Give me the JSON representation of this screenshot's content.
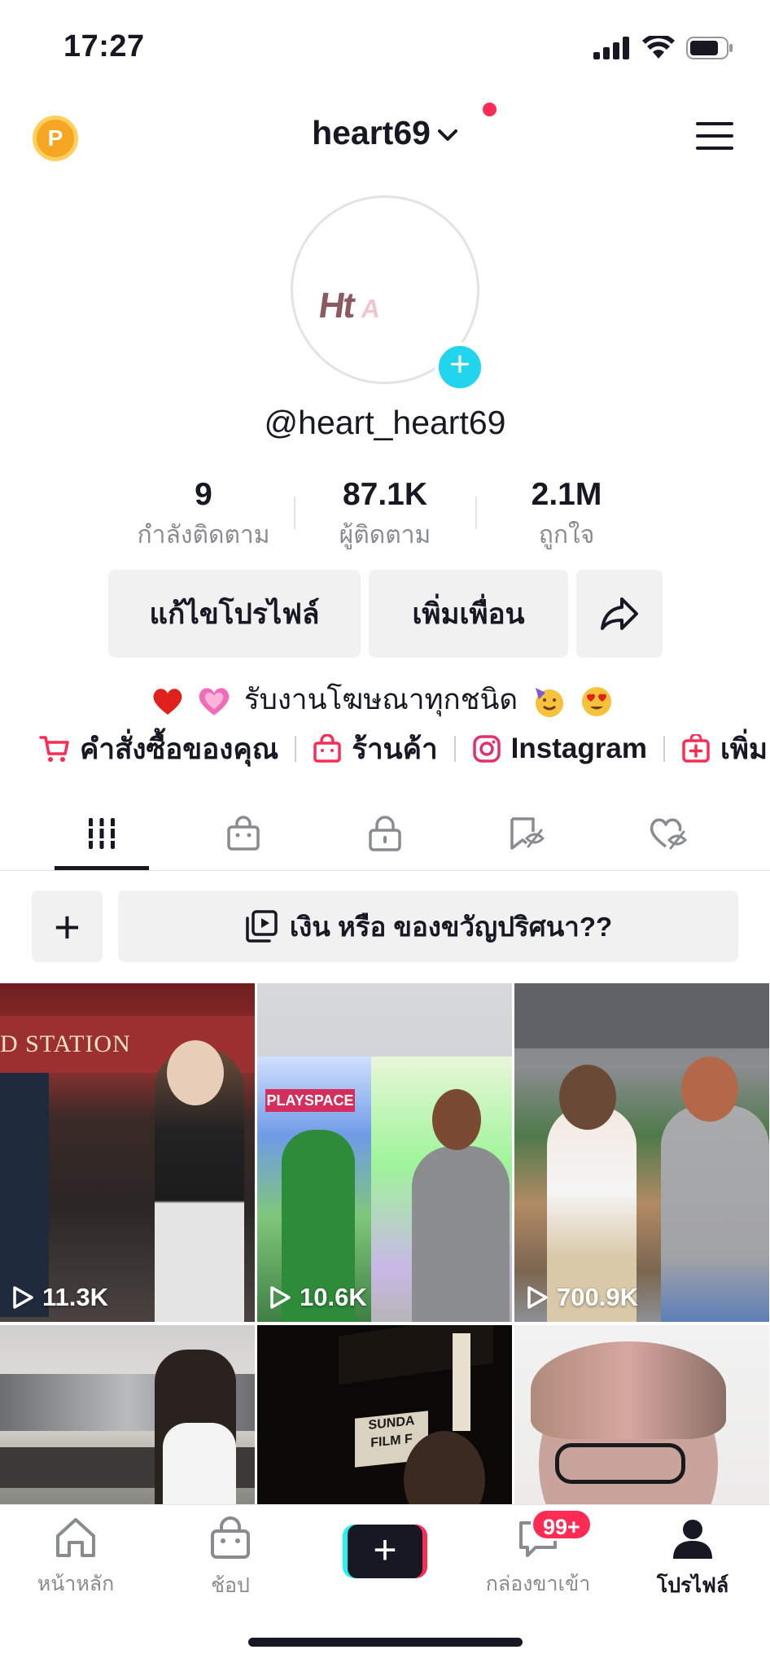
{
  "status_bar": {
    "time": "17:27"
  },
  "header": {
    "username": "heart69",
    "coin_label": "P"
  },
  "profile": {
    "avatar_text": "Ht",
    "avatar_text_2": "A",
    "handle": "@heart_heart69",
    "stats": [
      {
        "value": "9",
        "label": "กำลังติดตาม"
      },
      {
        "value": "87.1K",
        "label": "ผู้ติดตาม"
      },
      {
        "value": "2.1M",
        "label": "ถูกใจ"
      }
    ],
    "edit_profile_label": "แก้ไขโปรไฟล์",
    "add_friends_label": "เพิ่มเพื่อน",
    "bio": "รับงานโฆษณาทุกชนิด",
    "links": [
      {
        "label": "คำสั่งซื้อของคุณ",
        "icon": "cart-icon"
      },
      {
        "label": "ร้านค้า",
        "icon": "shop-bag-icon"
      },
      {
        "label": "Instagram",
        "icon": "instagram-icon"
      },
      {
        "label": "เพิ่ม",
        "icon": "add-box-icon"
      }
    ]
  },
  "tabs": [
    {
      "name": "videos",
      "icon": "grid-icon",
      "active": true
    },
    {
      "name": "shop",
      "icon": "shop-bag-icon",
      "active": false
    },
    {
      "name": "private",
      "icon": "lock-icon",
      "active": false
    },
    {
      "name": "favorites",
      "icon": "bookmark-hidden-icon",
      "active": false
    },
    {
      "name": "liked",
      "icon": "heart-hidden-icon",
      "active": false
    }
  ],
  "playlist": {
    "add_label": "+",
    "title": "เงิน หรือ ของขวัญปริศนา??"
  },
  "videos": [
    {
      "views": "11.3K"
    },
    {
      "views": "10.6K"
    },
    {
      "views": "700.9K"
    },
    {
      "views": ""
    },
    {
      "views": ""
    },
    {
      "views": ""
    }
  ],
  "bottom_nav": {
    "home": "หน้าหลัก",
    "shop": "ช้อป",
    "inbox": "กล่องขาเข้า",
    "inbox_badge": "99+",
    "profile": "โปรไฟล์"
  },
  "colors": {
    "accent": "#fe2c55",
    "cyan": "#20d5ec",
    "text": "#161823",
    "muted": "#8a8b91"
  }
}
